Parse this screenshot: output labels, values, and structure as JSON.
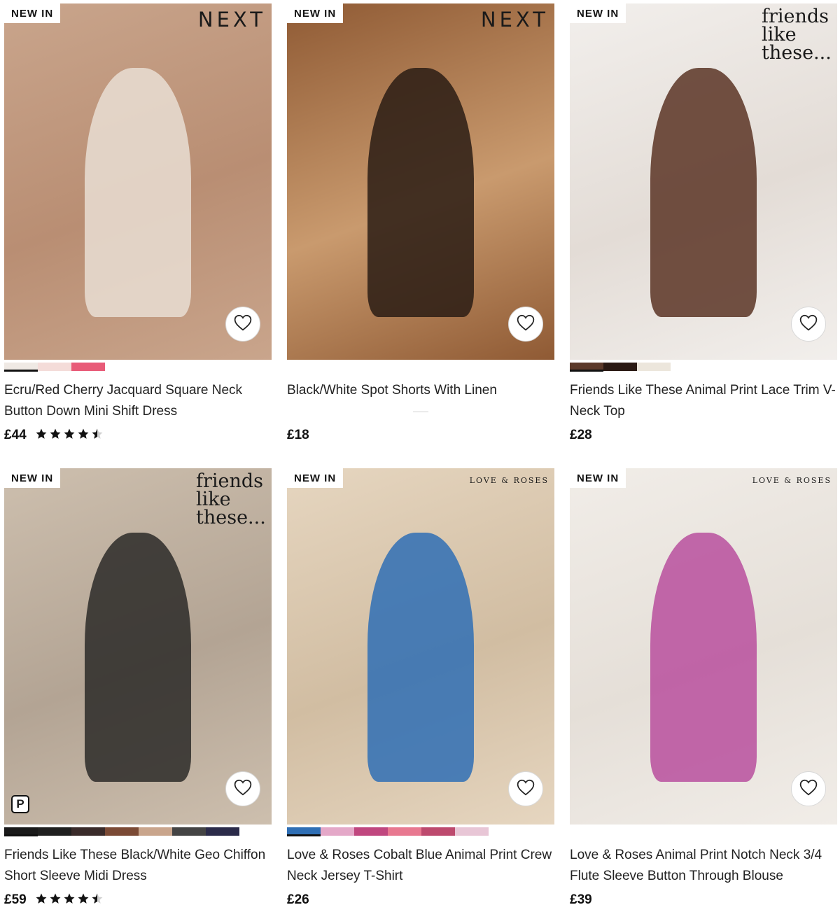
{
  "products": [
    {
      "badge": "NEW IN",
      "brand": "NEXT",
      "brand_style": "next",
      "image_desc_colors": [
        "#c9a58c",
        "#b98e73",
        "#e9ded4"
      ],
      "swatches": [
        "#efe9e4",
        "#f4dcd9",
        "#e85b78"
      ],
      "selected_swatch": 0,
      "title": "Ecru/Red Cherry Jacquard Square Neck Button Down Mini Shift Dress",
      "price": "£44",
      "rating": 4.5,
      "icon": "heart-icon"
    },
    {
      "badge": "NEW IN",
      "brand": "NEXT",
      "brand_style": "next",
      "image_desc_colors": [
        "#8f5a34",
        "#c99a6e",
        "#2a1c14"
      ],
      "swatches": [],
      "selected_swatch": null,
      "title": "Black/White Spot Shorts With Linen",
      "price": "£18",
      "rating": null,
      "icon": "heart-icon"
    },
    {
      "badge": "NEW IN",
      "brand": "friends like these...",
      "brand_style": "friends",
      "image_desc_colors": [
        "#f2efec",
        "#e3dcd6",
        "#5b3424"
      ],
      "swatches": [
        "#5c3a2b",
        "#2b1a14",
        "#ece6dc"
      ],
      "selected_swatch": 0,
      "title": "Friends Like These Animal Print Lace Trim V-Neck Top",
      "price": "£28",
      "rating": null,
      "icon": "heart-icon"
    },
    {
      "badge": "NEW IN",
      "brand": "friends like these...",
      "brand_style": "friends",
      "image_desc_colors": [
        "#cdbfae",
        "#b3a494",
        "#2b2a28"
      ],
      "swatches": [
        "#1a1a1a",
        "#20201f",
        "#3a2b2a",
        "#7b4a35",
        "#c9a58c",
        "#444",
        "#2b2b4a"
      ],
      "selected_swatch": 0,
      "title": "Friends Like These Black/White Geo Chiffon Short Sleeve Midi Dress",
      "price": "£59",
      "rating": 4.5,
      "pay_icon": "P",
      "icon": "heart-icon"
    },
    {
      "badge": "NEW IN",
      "brand": "LOVE & ROSES",
      "brand_style": "loveroses",
      "image_desc_colors": [
        "#e6d6c0",
        "#d1bda2",
        "#2f6fb5"
      ],
      "swatches": [
        "#2f6fb5",
        "#e4a8c8",
        "#c0477f",
        "#e87890",
        "#bd4a6e",
        "#e8c6d6"
      ],
      "selected_swatch": 0,
      "title": "Love & Roses Cobalt Blue Animal Print Crew Neck Jersey T-Shirt",
      "price": "£26",
      "rating": null,
      "icon": "heart-icon"
    },
    {
      "badge": "NEW IN",
      "brand": "LOVE & ROSES",
      "brand_style": "loveroses",
      "image_desc_colors": [
        "#f1ede8",
        "#e5dfd8",
        "#b84f9e"
      ],
      "swatches": [],
      "selected_swatch": null,
      "title": "Love & Roses Animal Print Notch Neck 3/4 Flute Sleeve Button Through Blouse",
      "price": "£39",
      "rating": null,
      "icon": "heart-icon"
    }
  ]
}
